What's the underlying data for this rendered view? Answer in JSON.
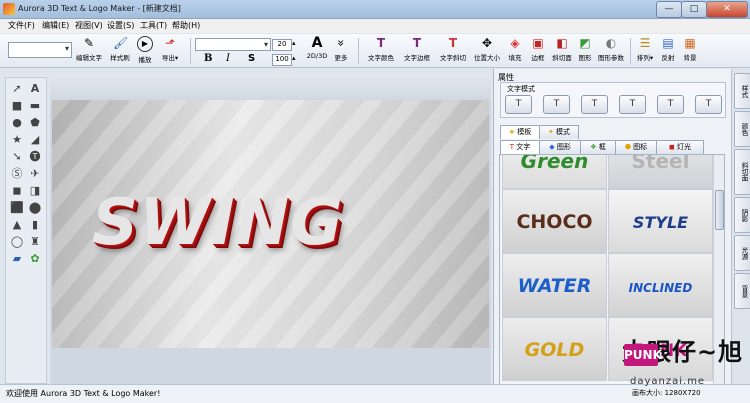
{
  "window": {
    "title": "Aurora 3D Text & Logo Maker - [新建文档]",
    "controls": {
      "minimize": "—",
      "maximize": "□",
      "close": "✕"
    }
  },
  "menu": [
    "文件(F)",
    "编辑(E)",
    "视图(V)",
    "设置(S)",
    "工具(T)",
    "帮助(H)"
  ],
  "toolbar": {
    "left_buttons": [
      {
        "label": "编辑文字",
        "icon": "pencil-icon",
        "glyph": "✎"
      },
      {
        "label": "样式刷",
        "icon": "brush-icon",
        "glyph": "🖌"
      },
      {
        "label": "播放",
        "icon": "play-icon",
        "glyph": "▶"
      },
      {
        "label": "导出▾",
        "icon": "export-icon",
        "glyph": "⬏"
      }
    ],
    "font_size_top": "20",
    "font_size_bottom": "100",
    "format_buttons": [
      "B",
      "I",
      "S"
    ],
    "mode_buttons": [
      {
        "label": "2D/3D",
        "glyph": "A"
      },
      {
        "label": "更多",
        "glyph": "»"
      }
    ],
    "right_buttons": [
      {
        "label": "文字颜色",
        "icon": "text-color-icon",
        "glyph": "T"
      },
      {
        "label": "文字边框",
        "icon": "text-border-icon",
        "glyph": "T"
      },
      {
        "label": "文字斜切",
        "icon": "text-bevel-icon",
        "glyph": "T"
      },
      {
        "label": "位置大小",
        "icon": "position-icon",
        "glyph": "✥"
      },
      {
        "label": "填充",
        "icon": "fill-icon",
        "glyph": "◈"
      },
      {
        "label": "边框",
        "icon": "border-icon",
        "glyph": "▣"
      },
      {
        "label": "斜切面",
        "icon": "bevel-icon",
        "glyph": "◧"
      },
      {
        "label": "图形",
        "icon": "shape-icon",
        "glyph": "◩"
      },
      {
        "label": "图形参数",
        "icon": "shape-params-icon",
        "glyph": "◐"
      },
      {
        "label": "排列▾",
        "icon": "arrange-icon",
        "glyph": "☰"
      },
      {
        "label": "反射",
        "icon": "reflect-icon",
        "glyph": "▤"
      },
      {
        "label": "背景",
        "icon": "background-icon",
        "glyph": "▦"
      }
    ]
  },
  "canvas": {
    "text": "SWING"
  },
  "panel": {
    "title": "属性",
    "style_group_caption": "文字模式",
    "style_buttons": [
      "T",
      "T",
      "T",
      "T",
      "T",
      "T"
    ],
    "upper_tabs": [
      {
        "label": "模板",
        "icon": "star-icon"
      },
      {
        "label": "模式",
        "icon": "mode-icon"
      }
    ],
    "lower_tabs": [
      {
        "label": "文字",
        "icon": "text-icon"
      },
      {
        "label": "图形",
        "icon": "shape-icon"
      },
      {
        "label": "框",
        "icon": "frame-icon"
      },
      {
        "label": "图标",
        "icon": "icon-icon"
      },
      {
        "label": "灯光",
        "icon": "light-icon"
      }
    ],
    "gallery": [
      {
        "text": "Green",
        "color": "#2e8b2e"
      },
      {
        "text": "Steel",
        "color": "#a9a9a9"
      },
      {
        "text": "CHOCO",
        "color": "#5a2d1a"
      },
      {
        "text": "STYLE",
        "color": "#1f3d8a"
      },
      {
        "text": "WATER",
        "color": "#1d5fc9"
      },
      {
        "text": "INCLINED",
        "color": "#1a55c8"
      },
      {
        "text": "GOLD",
        "color": "#d4a017"
      },
      {
        "text": "PUNK",
        "color": "#c2187d"
      }
    ]
  },
  "vtabs": [
    "样式",
    "颜色",
    "斜切面",
    "阴影",
    "光源",
    "背景"
  ],
  "status": {
    "message": "欢迎使用 Aurora 3D Text & Logo Maker!",
    "canvas_size": "画布大小: 1280X720"
  },
  "watermark": {
    "chinese": "大眼仔~旭",
    "url": "dayanzai.me",
    "badge": "PUNK"
  },
  "colors": {
    "accent": "#c8452e",
    "text_red": "#b11111"
  }
}
